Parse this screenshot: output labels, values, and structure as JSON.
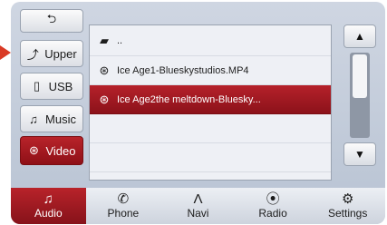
{
  "left_nav": {
    "back": {
      "icon": "back-arrow-icon"
    },
    "items": [
      {
        "label": "Upper",
        "icon": "up-arrow-icon"
      },
      {
        "label": "USB",
        "icon": "usb-icon"
      },
      {
        "label": "Music",
        "icon": "music-note-icon"
      },
      {
        "label": "Video",
        "icon": "video-reel-icon"
      }
    ]
  },
  "file_list": {
    "folder_row": {
      "label": "..",
      "icon": "folder-icon"
    },
    "files": [
      {
        "label": "Ice Age1-Blueskystudios.MP4",
        "icon": "video-reel-icon"
      },
      {
        "label": "Ice Age2the meltdown-Bluesky...",
        "icon": "video-reel-icon"
      }
    ]
  },
  "scroll": {
    "up": "▲",
    "down": "▼"
  },
  "bottom_nav": [
    {
      "label": "Audio",
      "icon": "music-note-icon"
    },
    {
      "label": "Phone",
      "icon": "phone-icon"
    },
    {
      "label": "Navi",
      "icon": "navi-arrow-icon"
    },
    {
      "label": "Radio",
      "icon": "radio-signal-icon"
    },
    {
      "label": "Settings",
      "icon": "gear-icon"
    }
  ],
  "colors": {
    "accent": "#a81a22",
    "background": "#c2cad8"
  }
}
